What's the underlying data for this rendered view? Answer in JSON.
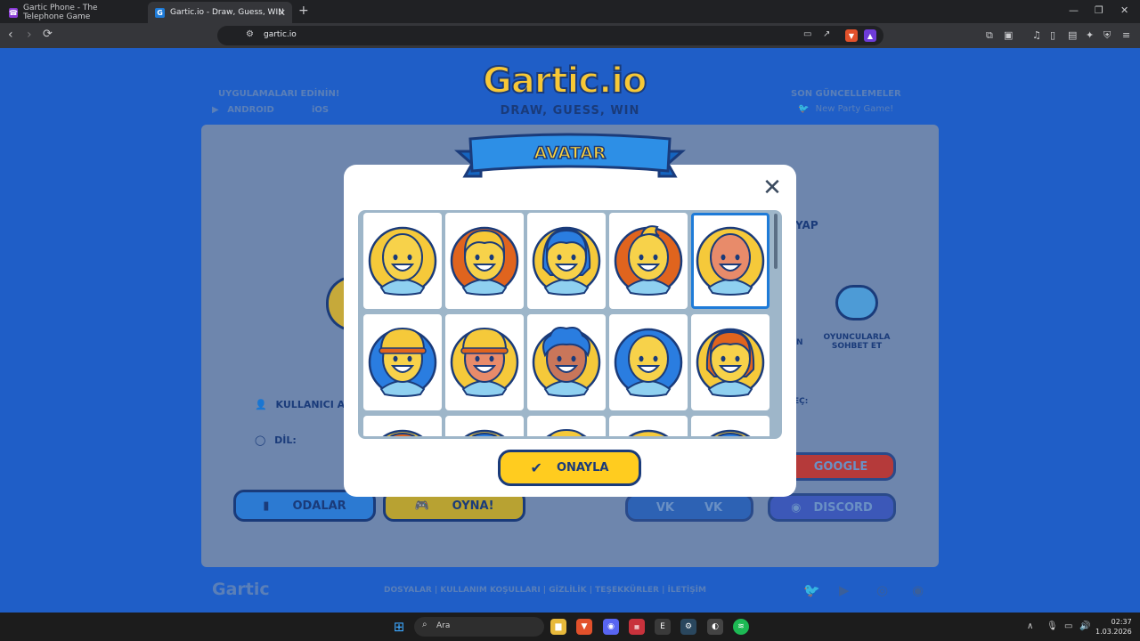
{
  "browser": {
    "tabs": [
      {
        "title": "Gartic Phone - The Telephone Game",
        "favicon": "phone-icon"
      },
      {
        "title": "Gartic.io - Draw, Guess, WIN",
        "favicon": "gartic-icon",
        "active": true
      }
    ],
    "new_tab": "+",
    "url": "gartic.io",
    "brave_badge": "1"
  },
  "page": {
    "logo": "Gartic.io",
    "tagline": "DRAW, GUESS, WIN",
    "apps_title": "UYGULAMALARI EDİNİN!",
    "android": "ANDROID",
    "ios": "iOS",
    "updates_title": "SON GÜNCELLEMELER",
    "updates_item": "New Party Game!",
    "partial_yap": "YAP",
    "partial_n": "N",
    "chat_feature": "OYUNCULARLA SOHBET ET",
    "username_label": "KULLANICI AI",
    "language_label": "DİL:",
    "partial_ec": "EÇ:",
    "buttons": {
      "rooms": "ODALAR",
      "play": "OYNA!",
      "google": "GOOGLE",
      "vk": "VK",
      "discord": "DISCORD"
    },
    "footer_logo": "Gartic",
    "footer_links": "DOSYALAR  |  KULLANIM KOŞULLARI  |  GİZLİLİK  |  TEŞEKKÜRLER  |  İLETİŞİM"
  },
  "modal": {
    "title": "AVATAR",
    "close": "✕",
    "confirm": "ONAYLA",
    "selected_index": 4,
    "avatars": [
      {
        "name": "avatar-bald-yellow",
        "bg": "#f5c93a",
        "hair": "none",
        "hair_color": "#f5c93a",
        "skin": "#f7d24a"
      },
      {
        "name": "avatar-blonde-boy",
        "bg": "#e0641e",
        "hair": "top",
        "hair_color": "#f7c836",
        "skin": "#f7d24a"
      },
      {
        "name": "avatar-blue-long-hair",
        "bg": "#f5c93a",
        "hair": "long",
        "hair_color": "#2a7de0",
        "skin": "#f7d24a"
      },
      {
        "name": "avatar-blonde-tuft",
        "bg": "#e0641e",
        "hair": "tuft",
        "hair_color": "#f7c836",
        "skin": "#f7d24a"
      },
      {
        "name": "avatar-bald-freckles",
        "bg": "#f5c93a",
        "hair": "none",
        "hair_color": "#e27a5a",
        "skin": "#e88b6a"
      },
      {
        "name": "avatar-yellow-cap-blue-hair",
        "bg": "#2a7de0",
        "hair": "cap",
        "hair_color": "#f5c93a",
        "skin": "#f7d24a"
      },
      {
        "name": "avatar-yellow-cap-boy",
        "bg": "#f5c93a",
        "hair": "cap",
        "hair_color": "#f5c93a",
        "skin": "#e88b6a"
      },
      {
        "name": "avatar-blue-curly-glasses",
        "bg": "#f5c93a",
        "hair": "curly",
        "hair_color": "#2a7de0",
        "skin": "#c9765a"
      },
      {
        "name": "avatar-bald-blue-bg",
        "bg": "#2a7de0",
        "hair": "none",
        "hair_color": "#2a7de0",
        "skin": "#f7d24a"
      },
      {
        "name": "avatar-orange-hair-glasses",
        "bg": "#f5c93a",
        "hair": "long",
        "hair_color": "#e0641e",
        "skin": "#f7d24a"
      },
      {
        "name": "avatar-row3-1",
        "bg": "#f5c93a",
        "hair": "top",
        "hair_color": "#e0641e",
        "skin": "#f7d24a"
      },
      {
        "name": "avatar-row3-2",
        "bg": "#f5c93a",
        "hair": "top",
        "hair_color": "#2a7de0",
        "skin": "#f7d24a"
      },
      {
        "name": "avatar-row3-3",
        "bg": "#f5c93a",
        "hair": "cap",
        "hair_color": "#f5c93a",
        "skin": "#f7d24a"
      },
      {
        "name": "avatar-row3-4",
        "bg": "#f5c93a",
        "hair": "none",
        "hair_color": "#f5c93a",
        "skin": "#f7d24a"
      },
      {
        "name": "avatar-row3-5",
        "bg": "#f5c93a",
        "hair": "top",
        "hair_color": "#2a7de0",
        "skin": "#f7d24a"
      }
    ]
  },
  "taskbar": {
    "search_placeholder": "Ara",
    "time": "02:37",
    "date": "1.03.2026"
  },
  "colors": {
    "page_bg": "#1f5ec7",
    "accent_yellow": "#ffcc1f",
    "dark_navy": "#1a3b7a",
    "select_blue": "#1e7bd8"
  }
}
